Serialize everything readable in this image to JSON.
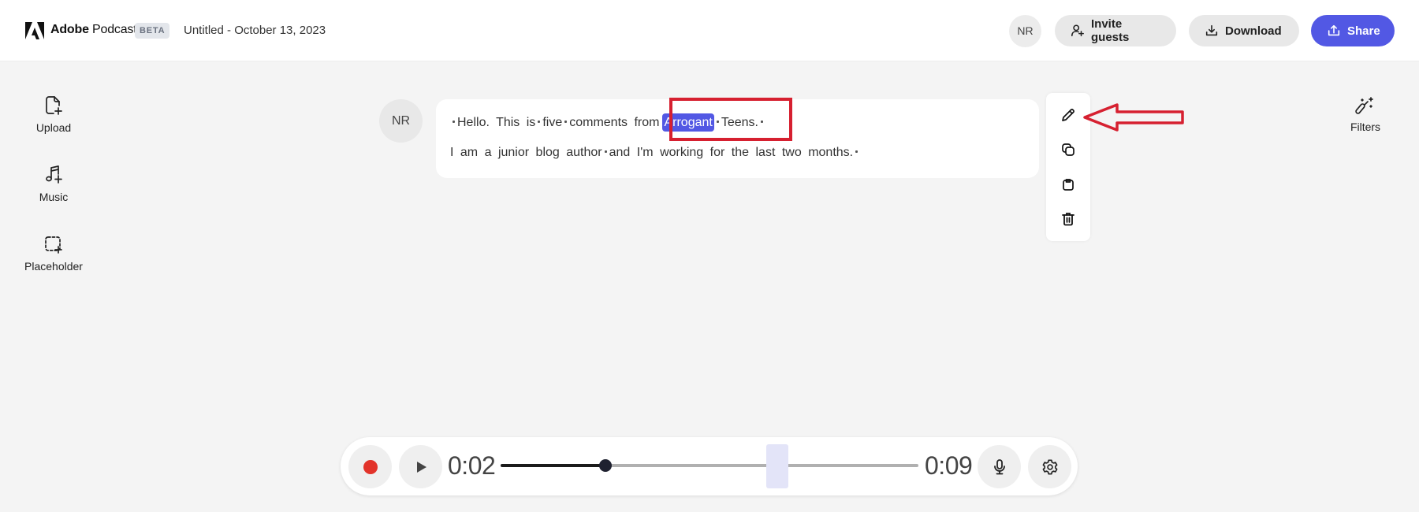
{
  "header": {
    "brand_bold": "Adobe",
    "brand_light": "Podcast",
    "badge": "BETA",
    "doc_title": "Untitled - October 13, 2023",
    "user_initials": "NR",
    "invite_label": "Invite guests",
    "download_label": "Download",
    "share_label": "Share"
  },
  "sidebar": {
    "items": [
      {
        "label": "Upload",
        "icon": "file-add-icon"
      },
      {
        "label": "Music",
        "icon": "music-add-icon"
      },
      {
        "label": "Placeholder",
        "icon": "placeholder-add-icon"
      }
    ]
  },
  "right_panel": {
    "filters_label": "Filters",
    "icon": "magic-wand-icon"
  },
  "transcript": {
    "speaker_initials": "NR",
    "line1": [
      "Hello.",
      "This",
      "is",
      "five",
      "comments",
      "from",
      "Arrogant",
      "Teens."
    ],
    "line1_selected_word": "Arrogant",
    "line2": [
      "I",
      "am",
      "a",
      "junior",
      "blog",
      "author",
      "and",
      "I'm",
      "working",
      "for",
      "the",
      "last",
      "two",
      "months."
    ]
  },
  "actions": [
    {
      "name": "edit",
      "icon": "pencil-icon"
    },
    {
      "name": "duplicate",
      "icon": "duplicate-icon"
    },
    {
      "name": "paste",
      "icon": "clipboard-icon"
    },
    {
      "name": "delete",
      "icon": "trash-icon"
    }
  ],
  "player": {
    "current_time": "0:02",
    "total_time": "0:09",
    "progress_fraction": 0.25
  },
  "colors": {
    "accent": "#5258e4",
    "record": "#e2332a",
    "annotation": "#d62030"
  }
}
